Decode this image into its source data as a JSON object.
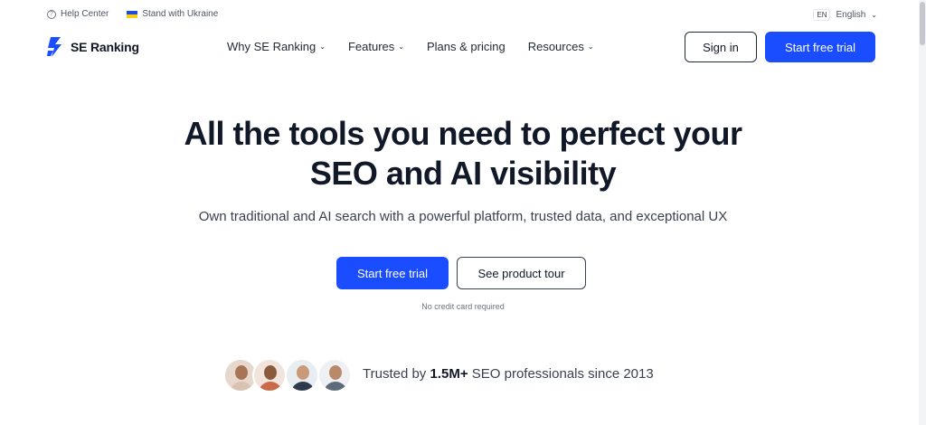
{
  "topbar": {
    "help_label": "Help Center",
    "ukraine_label": "Stand with Ukraine",
    "lang_code": "EN",
    "lang_label": "English"
  },
  "nav": {
    "logo_text": "SE Ranking",
    "items": [
      {
        "label": "Why SE Ranking",
        "has_caret": true
      },
      {
        "label": "Features",
        "has_caret": true
      },
      {
        "label": "Plans & pricing",
        "has_caret": false
      },
      {
        "label": "Resources",
        "has_caret": true
      }
    ],
    "signin_label": "Sign in",
    "trial_label": "Start free trial"
  },
  "hero": {
    "title_line1": "All the tools you need to perfect your",
    "title_line2": "SEO and AI visibility",
    "subtitle": "Own traditional and AI search with a powerful platform, trusted data, and exceptional UX",
    "primary_cta": "Start free trial",
    "secondary_cta": "See product tour",
    "note": "No credit card required"
  },
  "trust": {
    "prefix": "Trusted by ",
    "count": "1.5M+",
    "suffix": " SEO professionals since 2013"
  },
  "colors": {
    "accent": "#1a4dff",
    "text": "#111827"
  }
}
